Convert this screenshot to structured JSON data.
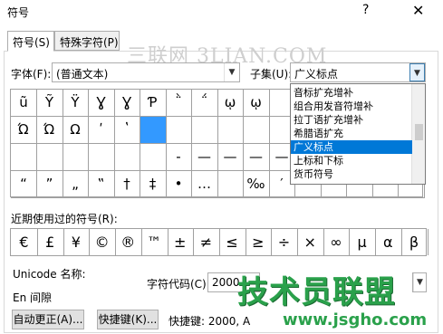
{
  "window": {
    "title": "符号",
    "help_glyph": "?",
    "close_glyph": "✕"
  },
  "tabs": [
    {
      "label": "符号(S)"
    },
    {
      "label": "特殊字符(P)"
    }
  ],
  "watermark_top": "三联网 3LIAN.COM",
  "font": {
    "label": "字体(F):",
    "value": "(普通文本)"
  },
  "subset": {
    "label": "子集(U):",
    "value": "广义标点",
    "options": [
      "音标扩充增补",
      "组合用发音符增补",
      "拉丁语扩充增补",
      "希腊语扩充",
      "广义标点",
      "上标和下标",
      "货币符号"
    ],
    "highlighted_index": 4
  },
  "symbol_grid": {
    "rows": [
      [
        "ũ",
        "Ỹ",
        "Ÿ",
        "Ɣ",
        "Ɣ",
        "Ƥ",
        "῭",
        "΅",
        "ῳ",
        "ῳ",
        "",
        "",
        "",
        "",
        "",
        ""
      ],
      [
        "Ώ",
        "Ώ",
        "Ω",
        "ʹ",
        "ʽ",
        "",
        "",
        "",
        "",
        "",
        "",
        "",
        "",
        "",
        "",
        ""
      ],
      [
        "",
        "",
        "",
        "",
        "",
        "",
        "-",
        "—",
        "—",
        "—",
        "—",
        "‖",
        "",
        "",
        "",
        ""
      ],
      [
        "“",
        "”",
        "„",
        "‟",
        "†",
        "‡",
        "•",
        "…",
        "",
        "‰",
        "′",
        "",
        "",
        "",
        "",
        ""
      ]
    ],
    "selected": [
      1,
      5
    ]
  },
  "recent": {
    "label": "近期使用过的符号(R):",
    "symbols": [
      "€",
      "£",
      "¥",
      "©",
      "®",
      "™",
      "±",
      "≠",
      "≤",
      "≥",
      "÷",
      "×",
      "∞",
      "μ",
      "α",
      "β"
    ]
  },
  "unicode_name": {
    "label": "Unicode 名称:",
    "value": "En 间隙"
  },
  "char_code": {
    "label": "字符代码(C):",
    "value": "2000"
  },
  "buttons": {
    "autocorrect": "自动更正(A)...",
    "shortcut_key": "快捷键(K)...",
    "shortcut_text": "快捷键: 2000, A"
  },
  "watermark_bottom": {
    "logo": "技术员联盟",
    "url": "www.jsgho.com"
  }
}
